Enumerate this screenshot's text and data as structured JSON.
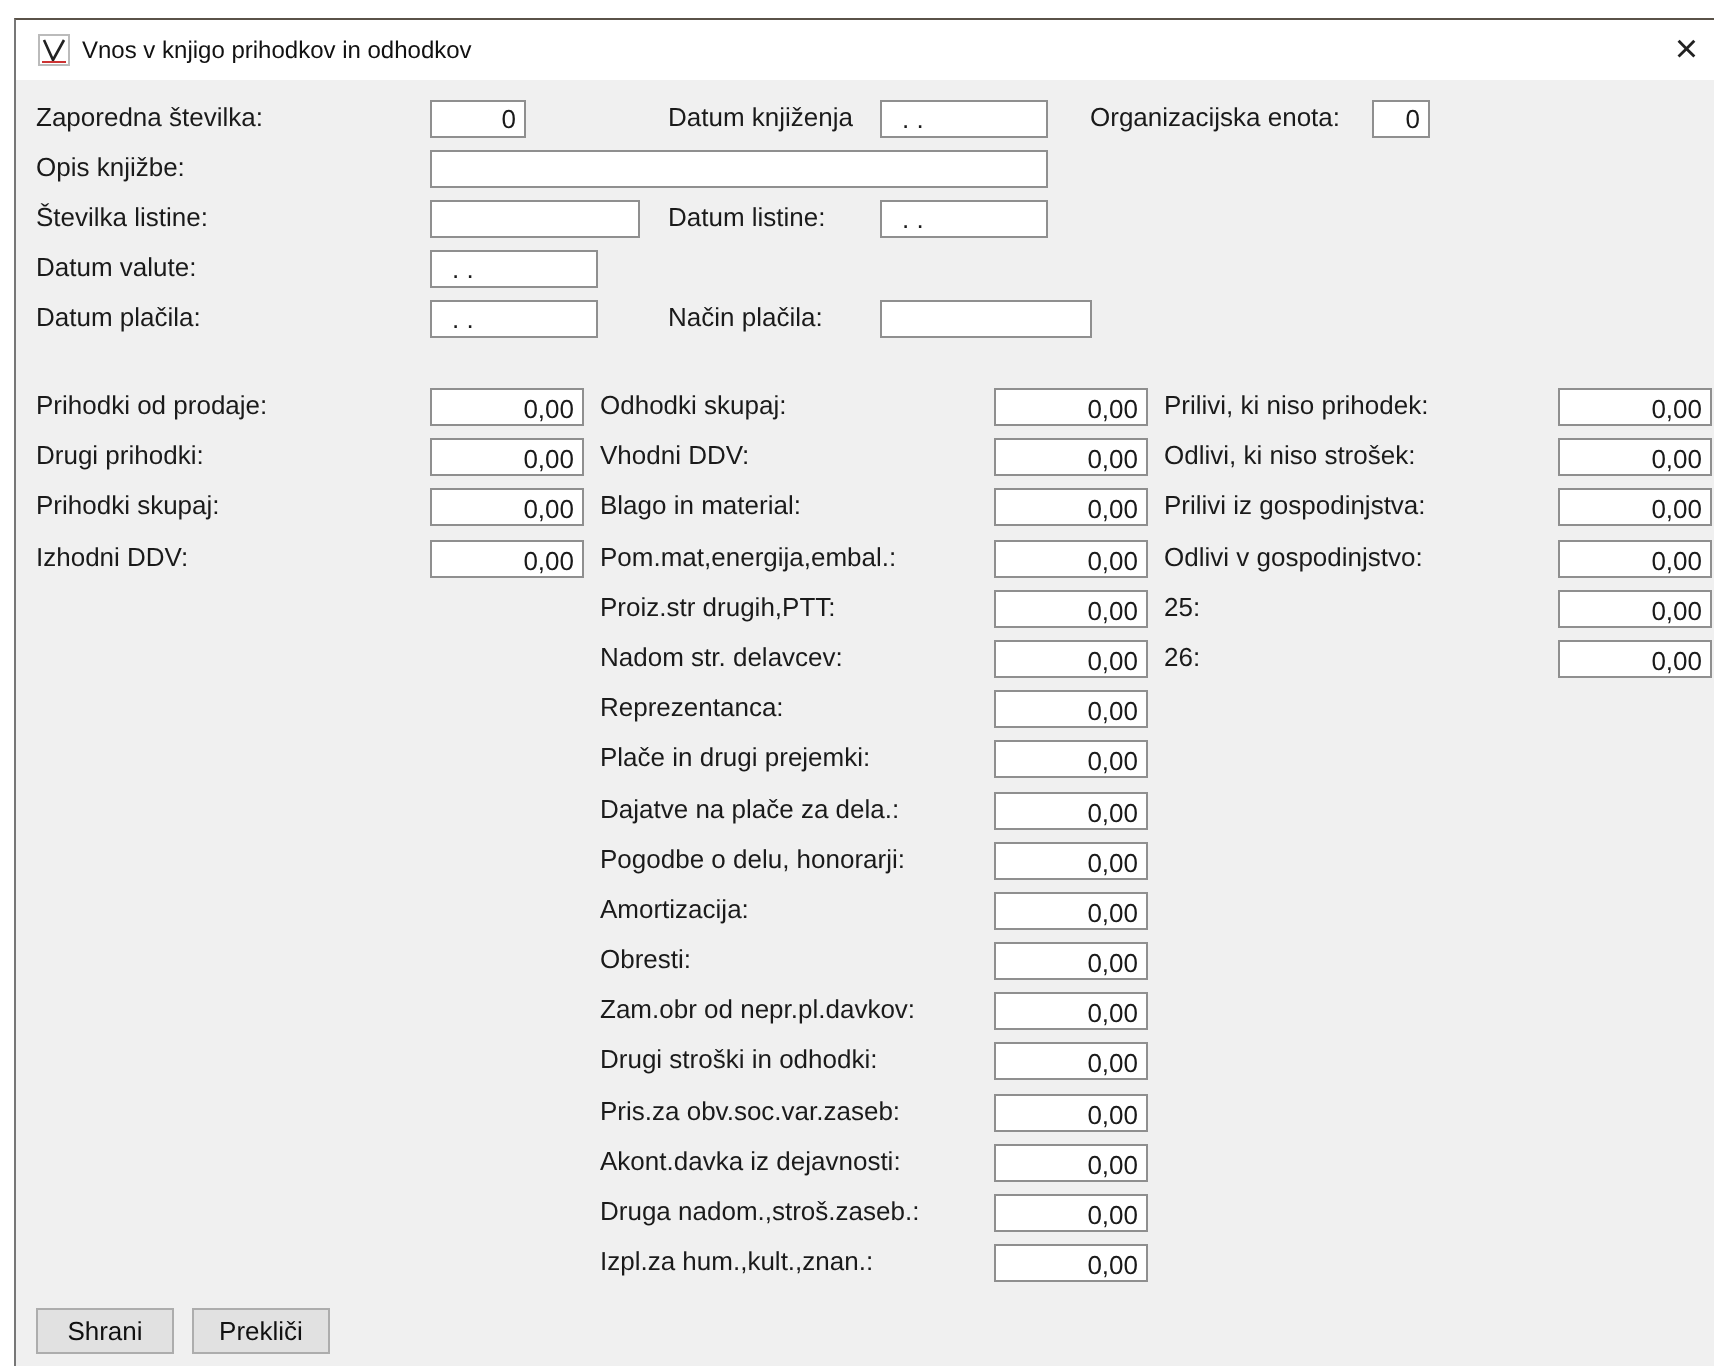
{
  "window": {
    "title": "Vnos v knjigo prihodkov in odhodkov",
    "close": "×"
  },
  "header_rows": [
    [
      {
        "kind": "label",
        "text": "Zaporedna številka:"
      },
      {
        "kind": "number",
        "value": "0"
      },
      {
        "kind": "label",
        "text": "Datum knjiženja"
      },
      {
        "kind": "date",
        "value": ". ."
      },
      {
        "kind": "label",
        "text": "Organizacijska enota:"
      },
      {
        "kind": "number",
        "value": "0"
      }
    ],
    [
      {
        "kind": "label",
        "text": "Opis knjižbe:"
      },
      {
        "kind": "text"
      }
    ],
    [
      {
        "kind": "label",
        "text": "Številka listine:"
      },
      {
        "kind": "text"
      },
      {
        "kind": "label",
        "text": "Datum listine:"
      },
      {
        "kind": "date",
        "value": ". ."
      }
    ],
    [
      {
        "kind": "label",
        "text": "Datum valute:"
      },
      {
        "kind": "date",
        "value": ". ."
      }
    ],
    [
      {
        "kind": "label",
        "text": "Datum plačila:"
      },
      {
        "kind": "date",
        "value": ". ."
      },
      {
        "kind": "label",
        "text": "Način plačila:"
      },
      {
        "kind": "text"
      }
    ]
  ],
  "amount_columns": [
    [
      {
        "label": "Prihodki od prodaje:",
        "value": "0,00"
      },
      {
        "label": "Drugi prihodki:",
        "value": "0,00"
      },
      {
        "label": "Prihodki skupaj:",
        "value": "0,00"
      },
      {
        "label": "Izhodni DDV:",
        "value": "0,00"
      }
    ],
    [
      {
        "label": "Odhodki skupaj:",
        "value": "0,00"
      },
      {
        "label": "Vhodni DDV:",
        "value": "0,00"
      },
      {
        "label": "Blago in material:",
        "value": "0,00"
      },
      {
        "label": "Pom.mat,energija,embal.:",
        "value": "0,00"
      },
      {
        "label": "Proiz.str drugih,PTT:",
        "value": "0,00"
      },
      {
        "label": "Nadom str. delavcev:",
        "value": "0,00"
      },
      {
        "label": "Reprezentanca:",
        "value": "0,00"
      },
      {
        "label": "Plače in drugi prejemki:",
        "value": "0,00"
      },
      {
        "label": "Dajatve na plače za dela.:",
        "value": "0,00"
      },
      {
        "label": "Pogodbe o delu, honorarji:",
        "value": "0,00"
      },
      {
        "label": "Amortizacija:",
        "value": "0,00"
      },
      {
        "label": "Obresti:",
        "value": "0,00"
      },
      {
        "label": "Zam.obr od nepr.pl.davkov:",
        "value": "0,00"
      },
      {
        "label": "Drugi stroški in odhodki:",
        "value": "0,00"
      },
      {
        "label": "Pris.za obv.soc.var.zaseb:",
        "value": "0,00"
      },
      {
        "label": "Akont.davka iz dejavnosti:",
        "value": "0,00"
      },
      {
        "label": "Druga nadom.,stroš.zaseb.:",
        "value": "0,00"
      },
      {
        "label": "Izpl.za hum.,kult.,znan.:",
        "value": "0,00"
      }
    ],
    [
      {
        "label": "Prilivi, ki niso prihodek:",
        "value": "0,00"
      },
      {
        "label": "Odlivi, ki niso strošek:",
        "value": "0,00"
      },
      {
        "label": "Prilivi iz gospodinjstva:",
        "value": "0,00"
      },
      {
        "label": "Odlivi v gospodinjstvo:",
        "value": "0,00"
      },
      {
        "label": "25:",
        "value": "0,00"
      },
      {
        "label": "26:",
        "value": "0,00"
      }
    ]
  ],
  "buttons": [
    "Shrani",
    "Prekliči"
  ]
}
